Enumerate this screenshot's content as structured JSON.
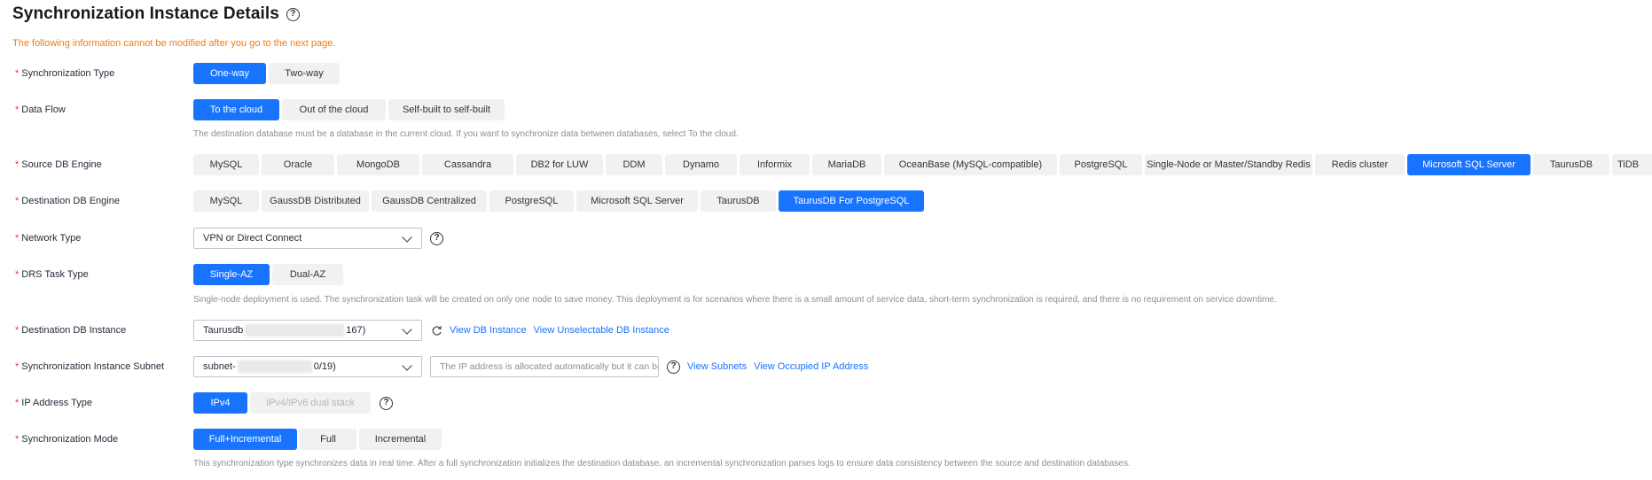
{
  "page": {
    "title": "Synchronization Instance Details",
    "notice": "The following information cannot be modified after you go to the next page."
  },
  "fields": {
    "sync_type": {
      "label": "Synchronization Type",
      "options": [
        "One-way",
        "Two-way"
      ],
      "selected": "One-way"
    },
    "data_flow": {
      "label": "Data Flow",
      "options": [
        "To the cloud",
        "Out of the cloud",
        "Self-built to self-built"
      ],
      "selected": "To the cloud",
      "hint": "The destination database must be a database in the current cloud. If you want to synchronize data between databases, select To the cloud."
    },
    "source_engine": {
      "label": "Source DB Engine",
      "options": [
        "MySQL",
        "Oracle",
        "MongoDB",
        "Cassandra",
        "DB2 for LUW",
        "DDM",
        "Dynamo",
        "Informix",
        "MariaDB",
        "OceanBase (MySQL-compatible)",
        "PostgreSQL",
        "Single-Node or Master/Standby Redis",
        "Redis cluster",
        "Microsoft SQL Server",
        "TaurusDB",
        "TiDB"
      ],
      "selected": "Microsoft SQL Server"
    },
    "dest_engine": {
      "label": "Destination DB Engine",
      "options": [
        "MySQL",
        "GaussDB Distributed",
        "GaussDB Centralized",
        "PostgreSQL",
        "Microsoft SQL Server",
        "TaurusDB",
        "TaurusDB For PostgreSQL"
      ],
      "selected": "TaurusDB For PostgreSQL"
    },
    "network_type": {
      "label": "Network Type",
      "value": "VPN or Direct Connect"
    },
    "task_type": {
      "label": "DRS Task Type",
      "options": [
        "Single-AZ",
        "Dual-AZ"
      ],
      "selected": "Single-AZ",
      "hint": "Single-node deployment is used. The synchronization task will be created on only one node to save money. This deployment is for scenarios where there is a small amount of service data, short-term synchronization is required, and there is no requirement on service downtime."
    },
    "dest_instance": {
      "label": "Destination DB Instance",
      "value_prefix": "Taurusdb",
      "value_suffix": "167)",
      "view_link": "View DB Instance",
      "unselectable_link": "View Unselectable DB Instance"
    },
    "subnet": {
      "label": "Synchronization Instance Subnet",
      "value_prefix": "subnet-",
      "value_suffix": "0/19)",
      "ip_placeholder": "The IP address is allocated automatically but it can be",
      "view_subnets": "View Subnets",
      "view_ip": "View Occupied IP Address"
    },
    "ip_type": {
      "label": "IP Address Type",
      "options": [
        "IPv4",
        "IPv4/IPv6 dual stack"
      ],
      "selected": "IPv4"
    },
    "sync_mode": {
      "label": "Synchronization Mode",
      "options": [
        "Full+Incremental",
        "Full",
        "Incremental"
      ],
      "selected": "Full+Incremental",
      "hint": "This synchronization type synchronizes data in real time. After a full synchronization initializes the destination database, an incremental synchronization parses logs to ensure data consistency between the source and destination databases."
    }
  },
  "colors": {
    "accent": "#1874ff",
    "notice": "#ef7d13",
    "required": "#e0393e"
  }
}
